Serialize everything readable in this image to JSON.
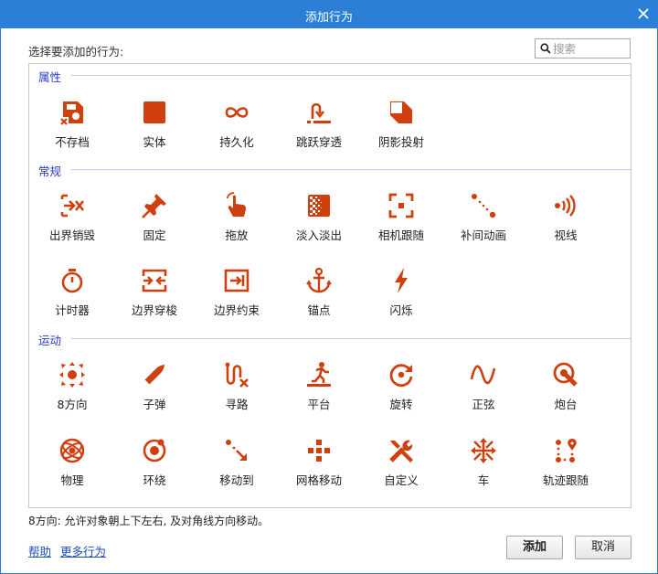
{
  "title": "添加行为",
  "prompt": "选择要添加的行为:",
  "search": {
    "placeholder": "搜索",
    "value": ""
  },
  "categories": [
    {
      "label": "属性"
    },
    {
      "label": "常规"
    },
    {
      "label": "运动"
    }
  ],
  "behaviors": [
    {
      "label": "不存档",
      "icon": "no-save-icon"
    },
    {
      "label": "实体",
      "icon": "solid-icon"
    },
    {
      "label": "持久化",
      "icon": "persist-icon"
    },
    {
      "label": "跳跃穿透",
      "icon": "jump-thru-icon"
    },
    {
      "label": "阴影投射",
      "icon": "shadow-caster-icon"
    },
    {
      "label": "出界销毁",
      "icon": "destroy-outside-icon"
    },
    {
      "label": "固定",
      "icon": "pin-icon"
    },
    {
      "label": "拖放",
      "icon": "drag-drop-icon"
    },
    {
      "label": "淡入淡出",
      "icon": "fade-icon"
    },
    {
      "label": "相机跟随",
      "icon": "scroll-to-icon"
    },
    {
      "label": "补间动画",
      "icon": "tween-icon"
    },
    {
      "label": "视线",
      "icon": "line-of-sight-icon"
    },
    {
      "label": "计时器",
      "icon": "timer-icon"
    },
    {
      "label": "边界穿梭",
      "icon": "wrap-icon"
    },
    {
      "label": "边界约束",
      "icon": "bound-to-layout-icon"
    },
    {
      "label": "锚点",
      "icon": "anchor-icon"
    },
    {
      "label": "闪烁",
      "icon": "flash-icon"
    },
    {
      "label": "8方向",
      "icon": "eight-direction-icon"
    },
    {
      "label": "子弹",
      "icon": "bullet-icon"
    },
    {
      "label": "寻路",
      "icon": "pathfinding-icon"
    },
    {
      "label": "平台",
      "icon": "platform-icon"
    },
    {
      "label": "旋转",
      "icon": "rotate-icon"
    },
    {
      "label": "正弦",
      "icon": "sine-icon"
    },
    {
      "label": "炮台",
      "icon": "turret-icon"
    },
    {
      "label": "物理",
      "icon": "physics-icon"
    },
    {
      "label": "环绕",
      "icon": "orbit-icon"
    },
    {
      "label": "移动到",
      "icon": "move-to-icon"
    },
    {
      "label": "网格移动",
      "icon": "tile-movement-icon"
    },
    {
      "label": "自定义",
      "icon": "custom-icon"
    },
    {
      "label": "车",
      "icon": "car-icon"
    },
    {
      "label": "轨迹跟随",
      "icon": "follow-icon"
    }
  ],
  "status_text": "8方向: 允许对象朝上下左右, 及对角线方向移动。",
  "links": {
    "help": "帮助",
    "more": "更多行为"
  },
  "buttons": {
    "add": "添加",
    "cancel": "取消"
  },
  "colors": {
    "accent": "#2b7fd6",
    "icon": "#d0400f",
    "category": "#2b3bc4",
    "link": "#1f4fb5"
  }
}
